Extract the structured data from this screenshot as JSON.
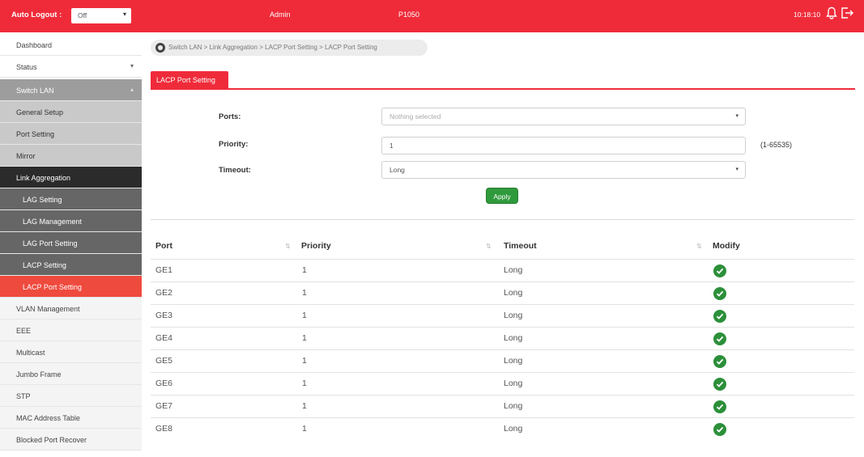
{
  "topbar": {
    "auto_logout_label": "Auto Logout :",
    "auto_logout_value": "Off",
    "user": "Admin",
    "model": "P1050",
    "time": "10:18:10"
  },
  "sidebar": {
    "dashboard": "Dashboard",
    "status": "Status",
    "switch_lan": "Switch LAN",
    "general_setup": "General Setup",
    "port_setting": "Port Setting",
    "mirror": "Mirror",
    "link_aggregation": "Link Aggregation",
    "lag_setting": "LAG Setting",
    "lag_management": "LAG Management",
    "lag_port_setting": "LAG Port Setting",
    "lacp_setting": "LACP Setting",
    "lacp_port_setting": "LACP Port Setting",
    "vlan_management": "VLAN Management",
    "eee": "EEE",
    "multicast": "Multicast",
    "jumbo_frame": "Jumbo Frame",
    "stp": "STP",
    "mac_address_table": "MAC Address Table",
    "blocked_port_recover": "Blocked Port Recover"
  },
  "breadcrumb": "Switch LAN > Link Aggregation > LACP Port Setting > LACP Port Setting",
  "tab_label": "LACP Port Setting",
  "form": {
    "ports_label": "Ports:",
    "ports_placeholder": "Nothing selected",
    "priority_label": "Priority:",
    "priority_value": "1",
    "priority_range": "(1-65535)",
    "timeout_label": "Timeout:",
    "timeout_value": "Long",
    "apply_label": "Apply"
  },
  "table": {
    "headers": {
      "port": "Port",
      "priority": "Priority",
      "timeout": "Timeout",
      "modify": "Modify"
    },
    "rows": [
      {
        "port": "GE1",
        "priority": "1",
        "timeout": "Long"
      },
      {
        "port": "GE2",
        "priority": "1",
        "timeout": "Long"
      },
      {
        "port": "GE3",
        "priority": "1",
        "timeout": "Long"
      },
      {
        "port": "GE4",
        "priority": "1",
        "timeout": "Long"
      },
      {
        "port": "GE5",
        "priority": "1",
        "timeout": "Long"
      },
      {
        "port": "GE6",
        "priority": "1",
        "timeout": "Long"
      },
      {
        "port": "GE7",
        "priority": "1",
        "timeout": "Long"
      },
      {
        "port": "GE8",
        "priority": "1",
        "timeout": "Long"
      }
    ]
  },
  "colors": {
    "brand_red": "#ef2b3a",
    "active_orange": "#ef4a3e",
    "apply_green": "#2f9a3c"
  },
  "icons": {
    "notification": "bell-icon",
    "logout": "logout-icon",
    "home": "home-icon",
    "modify": "edit-check-icon"
  }
}
